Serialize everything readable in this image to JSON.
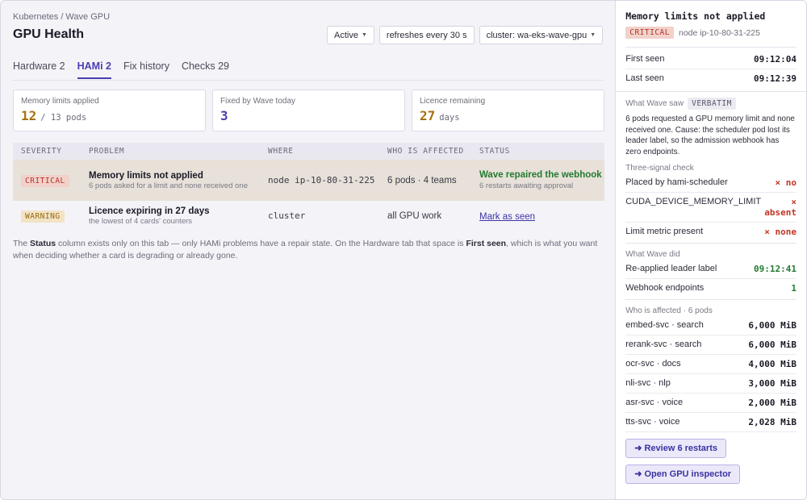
{
  "header": {
    "breadcrumb": "Kubernetes / Wave GPU",
    "title": "GPU Health",
    "controls": [
      {
        "label": "Active",
        "dropdown": true
      },
      {
        "label": "refreshes every 30 s",
        "dropdown": false
      },
      {
        "label": "cluster: wa-eks-wave-gpu",
        "dropdown": true
      }
    ]
  },
  "tabs": [
    {
      "label": "Hardware 2",
      "active": false
    },
    {
      "label": "HAMi 2",
      "active": true
    },
    {
      "label": "Fix history",
      "active": false
    },
    {
      "label": "Checks 29",
      "active": false
    }
  ],
  "stats": [
    {
      "label": "Memory limits applied",
      "value": "12",
      "unit": "/ 13 pods"
    },
    {
      "label": "Fixed by Wave today",
      "value": "3",
      "unit": ""
    },
    {
      "label": "Licence remaining",
      "value": "27",
      "unit": "days"
    }
  ],
  "table": {
    "headers": [
      "SEVERITY",
      "PROBLEM",
      "WHERE",
      "WHO IS AFFECTED",
      "STATUS"
    ],
    "rows": [
      {
        "severity": "CRITICAL",
        "problem_title": "Memory limits not applied",
        "problem_sub": "6 pods asked for a limit and none received one",
        "where": "node ip-10-80-31-225",
        "who": "6 pods · 4 teams",
        "status": "Wave repaired the webhook",
        "status_sub": "6 restarts awaiting approval"
      },
      {
        "severity": "WARNING",
        "problem_title": "Licence expiring in 27 days",
        "problem_sub": "the lowest of 4 cards' counters",
        "where": "cluster",
        "who": "all GPU work",
        "status": "Mark as seen",
        "status_sub": ""
      }
    ]
  },
  "note": {
    "p1": "The ",
    "b1": "Status",
    "p2": " column exists only on this tab — only HAMi problems have a repair state. On the Hardware tab that space is ",
    "b2": "First seen",
    "p3": ", which is what you want when deciding whether a card is degrading or already gone."
  },
  "panel": {
    "title": "Memory limits not applied",
    "badge": "CRITICAL",
    "node": "node ip-10-80-31-225",
    "first_seen_label": "First seen",
    "first_seen": "09:12:04",
    "last_seen_label": "Last seen",
    "last_seen": "09:12:39",
    "wave_saw_label": "What Wave saw",
    "verbatim": "VERBATIM",
    "wave_saw_text": "6 pods requested a GPU memory limit and none received one. Cause: the scheduler pod lost its leader label, so the admission webhook has zero endpoints.",
    "signal_label": "Three-signal check",
    "signals": [
      {
        "label": "Placed by hami-scheduler",
        "value": "× no"
      },
      {
        "label": "CUDA_DEVICE_MEMORY_LIMIT",
        "value": "× absent"
      },
      {
        "label": "Limit metric present",
        "value": "× none"
      }
    ],
    "did_label": "What Wave did",
    "did": [
      {
        "label": "Re-applied leader label",
        "value": "09:12:41"
      },
      {
        "label": "Webhook endpoints",
        "value": "1"
      }
    ],
    "affected_label": "Who is affected · 6 pods",
    "affected": [
      {
        "label": "embed-svc · search",
        "value": "6,000 MiB"
      },
      {
        "label": "rerank-svc · search",
        "value": "6,000 MiB"
      },
      {
        "label": "ocr-svc · docs",
        "value": "4,000 MiB"
      },
      {
        "label": "nli-svc · nlp",
        "value": "3,000 MiB"
      },
      {
        "label": "asr-svc · voice",
        "value": "2,000 MiB"
      },
      {
        "label": "tts-svc · voice",
        "value": "2,028 MiB"
      }
    ],
    "btn_review": "➜ Review 6 restarts",
    "btn_inspector": "➜ Open GPU inspector"
  }
}
